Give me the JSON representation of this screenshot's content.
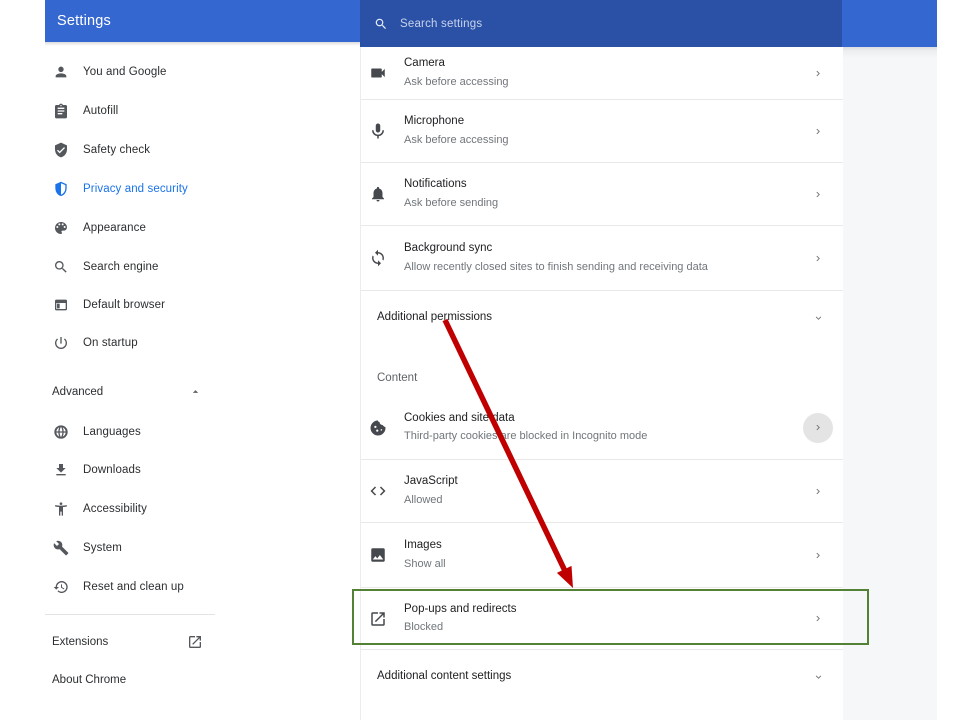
{
  "header": {
    "title": "Settings",
    "search_placeholder": "Search settings",
    "search_icon": "search-icon"
  },
  "sidebar": {
    "items": [
      {
        "label": "You and Google",
        "icon": "person-icon",
        "selected": false
      },
      {
        "label": "Autofill",
        "icon": "autofill-icon",
        "selected": false
      },
      {
        "label": "Safety check",
        "icon": "safety-check-icon",
        "selected": false
      },
      {
        "label": "Privacy and security",
        "icon": "privacy-shield-icon",
        "selected": true
      },
      {
        "label": "Appearance",
        "icon": "palette-icon",
        "selected": false
      },
      {
        "label": "Search engine",
        "icon": "search-engine-icon",
        "selected": false
      },
      {
        "label": "Default browser",
        "icon": "default-browser-icon",
        "selected": false
      },
      {
        "label": "On startup",
        "icon": "power-icon",
        "selected": false
      }
    ],
    "advanced_label": "Advanced",
    "advanced_state_icon": "caret-up-icon",
    "advanced_items": [
      {
        "label": "Languages",
        "icon": "globe-icon"
      },
      {
        "label": "Downloads",
        "icon": "download-icon"
      },
      {
        "label": "Accessibility",
        "icon": "accessibility-icon"
      },
      {
        "label": "System",
        "icon": "wrench-icon"
      },
      {
        "label": "Reset and clean up",
        "icon": "history-icon"
      }
    ],
    "extensions_label": "Extensions",
    "extensions_icon": "external-link-icon",
    "about_label": "About Chrome"
  },
  "content": {
    "permission_rows": [
      {
        "title": "Camera",
        "subtitle": "Ask before accessing",
        "icon": "camera-icon",
        "chevron": "chevron-right-icon"
      },
      {
        "title": "Microphone",
        "subtitle": "Ask before accessing",
        "icon": "microphone-icon",
        "chevron": "chevron-right-icon"
      },
      {
        "title": "Notifications",
        "subtitle": "Ask before sending",
        "icon": "bell-icon",
        "chevron": "chevron-right-icon"
      },
      {
        "title": "Background sync",
        "subtitle": "Allow recently closed sites to finish sending and receiving data",
        "icon": "sync-icon",
        "chevron": "chevron-right-icon"
      }
    ],
    "additional_permissions_label": "Additional permissions",
    "section_header": "Content",
    "content_rows": [
      {
        "title": "Cookies and site data",
        "subtitle": "Third-party cookies are blocked in Incognito mode",
        "icon": "cookie-icon",
        "chevron": "chevron-right-icon",
        "focused": true
      },
      {
        "title": "JavaScript",
        "subtitle": "Allowed",
        "icon": "code-icon",
        "chevron": "chevron-right-icon",
        "focused": false
      },
      {
        "title": "Images",
        "subtitle": "Show all",
        "icon": "image-icon",
        "chevron": "chevron-right-icon",
        "focused": false
      },
      {
        "title": "Pop-ups and redirects",
        "subtitle": "Blocked",
        "icon": "popup-icon",
        "chevron": "chevron-right-icon",
        "focused": false
      }
    ],
    "additional_content_label": "Additional content settings"
  },
  "annotations": {
    "highlighted_row": "Pop-ups and redirects",
    "arrow_points_from": "Additional permissions",
    "arrow_points_to": "Pop-ups and redirects"
  },
  "colors": {
    "toolbar_blue": "#3567d1",
    "search_blue": "#2b51a6",
    "selected_blue": "#1a73e8",
    "page_gray": "#f6f7f8",
    "arrow_red": "#c00000",
    "highlight_green": "#538135"
  }
}
